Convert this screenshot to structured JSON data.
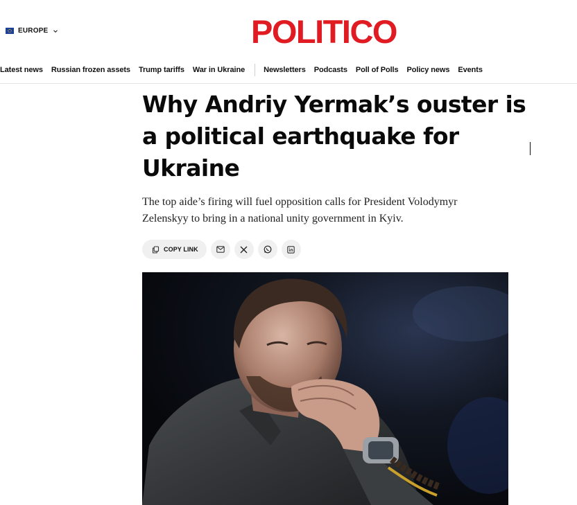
{
  "header": {
    "edition_label": "EUROPE",
    "logo_text": "POLITICO",
    "logo_color": "#e11b22"
  },
  "nav": {
    "left_items": [
      {
        "label": "Latest news"
      },
      {
        "label": "Russian frozen assets"
      },
      {
        "label": "Trump tariffs"
      },
      {
        "label": "War in Ukraine"
      }
    ],
    "right_items": [
      {
        "label": "Newsletters"
      },
      {
        "label": "Podcasts"
      },
      {
        "label": "Poll of Polls"
      },
      {
        "label": "Policy news"
      },
      {
        "label": "Events"
      }
    ]
  },
  "article": {
    "headline": "Why Andriy Yermak’s ouster is a political earthquake for Ukraine",
    "dek": "The top aide’s firing will fuel opposition calls for President Volodymyr Zelenskyy to bring in a national unity government in Kyiv."
  },
  "share": {
    "copy_link_label": "COPY LINK",
    "icons": [
      "link-icon",
      "email-icon",
      "x-icon",
      "whatsapp-icon",
      "linkedin-icon"
    ]
  },
  "hero_image": {
    "subject": "photo"
  }
}
